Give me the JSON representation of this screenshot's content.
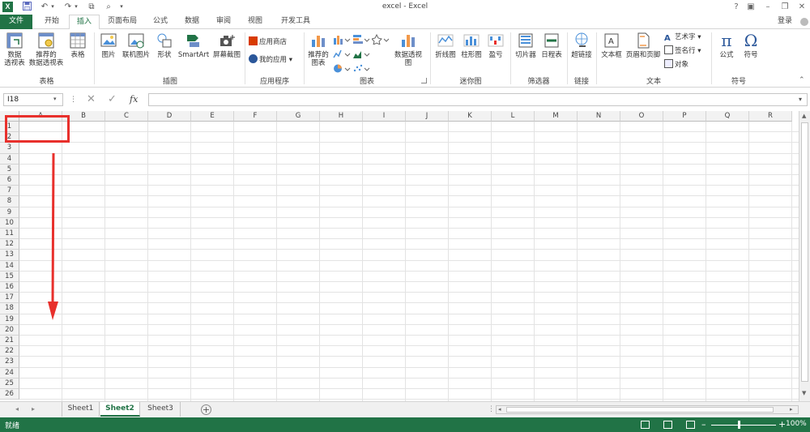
{
  "window": {
    "title": "excel - Excel",
    "help": "?",
    "login": "登录"
  },
  "tabs": [
    {
      "label": "文件"
    },
    {
      "label": "开始"
    },
    {
      "label": "插入"
    },
    {
      "label": "页面布局"
    },
    {
      "label": "公式"
    },
    {
      "label": "数据"
    },
    {
      "label": "审阅"
    },
    {
      "label": "视图"
    },
    {
      "label": "开发工具"
    }
  ],
  "ribbon": {
    "groups": {
      "tables": "表格",
      "illustrations": "插图",
      "apps": "应用程序",
      "charts": "图表",
      "sparklines": "迷你图",
      "filters": "筛选器",
      "links": "链接",
      "text": "文本",
      "symbols": "符号"
    },
    "buttons": {
      "pivot_line1": "数据",
      "pivot_line2": "透视表",
      "rec_pivot_line1": "推荐的",
      "rec_pivot_line2": "数据透视表",
      "table": "表格",
      "picture": "图片",
      "online_picture": "联机图片",
      "shapes": "形状",
      "smartart": "SmartArt",
      "screenshot": "屏幕截图",
      "app_store": "应用商店",
      "my_apps": "我的应用",
      "rec_chart_line1": "推荐的",
      "rec_chart_line2": "图表",
      "pivot_chart": "数据透视图",
      "line_spark": "折线图",
      "column_spark": "柱形图",
      "winloss_spark": "盈亏",
      "slicer": "切片器",
      "timeline": "日程表",
      "hyperlink": "超链接",
      "textbox": "文本框",
      "header_footer": "页眉和页脚",
      "wordart": "艺术字",
      "signature": "签名行",
      "object": "对象",
      "equation": "公式",
      "symbol": "符号"
    }
  },
  "formula_bar": {
    "name_box": "I18",
    "fx": "fx",
    "value": ""
  },
  "columns": [
    "A",
    "B",
    "C",
    "D",
    "E",
    "F",
    "G",
    "H",
    "I",
    "J",
    "K",
    "L",
    "M",
    "N",
    "O",
    "P",
    "Q",
    "R"
  ],
  "rows": [
    "1",
    "2",
    "3",
    "4",
    "5",
    "6",
    "7",
    "8",
    "9",
    "10",
    "11",
    "12",
    "13",
    "14",
    "15",
    "16",
    "17",
    "18",
    "19",
    "20",
    "21",
    "22",
    "23",
    "24",
    "25",
    "26"
  ],
  "sheets": [
    {
      "label": "Sheet1"
    },
    {
      "label": "Sheet2"
    },
    {
      "label": "Sheet3"
    }
  ],
  "status": {
    "ready": "就绪",
    "zoom": "100%"
  },
  "colors": {
    "accent": "#217346",
    "annotation": "#e8302c"
  }
}
